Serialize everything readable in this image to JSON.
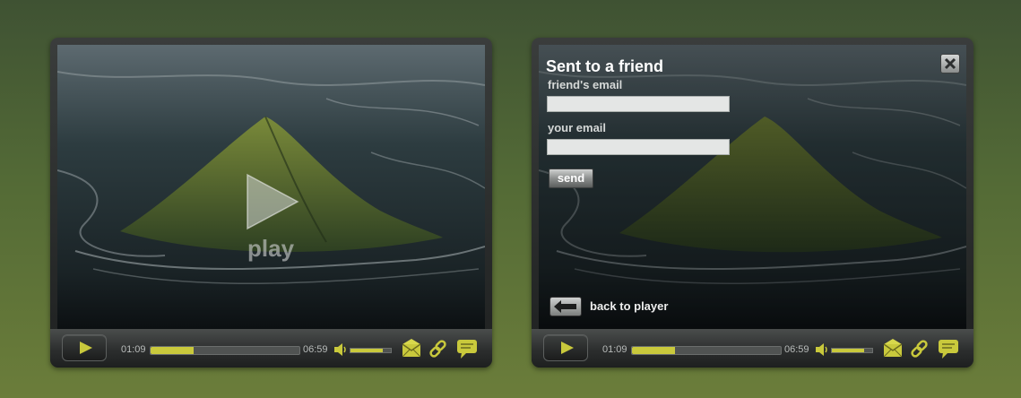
{
  "colors": {
    "accent": "#c9c93c",
    "bar_bg": "#505352",
    "frame": "#2c2e2e"
  },
  "players": [
    {
      "big_play_label": "play",
      "controls": {
        "current_time": "01:09",
        "duration": "06:59",
        "progress": 0.29,
        "volume": 0.8,
        "icons": [
          "play-icon",
          "volume-icon",
          "email-icon",
          "link-icon",
          "comment-icon"
        ]
      }
    },
    {
      "share_panel": {
        "title": "Sent to a friend",
        "friend_email_label": "friend's email",
        "friend_email_value": "",
        "your_email_label": "your email",
        "your_email_value": "",
        "send_label": "send",
        "back_label": "back to player",
        "icons": [
          "close-icon",
          "back-arrow-icon"
        ]
      },
      "controls": {
        "current_time": "01:09",
        "duration": "06:59",
        "progress": 0.29,
        "volume": 0.8,
        "icons": [
          "play-icon",
          "volume-icon",
          "email-icon",
          "link-icon",
          "comment-icon"
        ]
      }
    }
  ]
}
